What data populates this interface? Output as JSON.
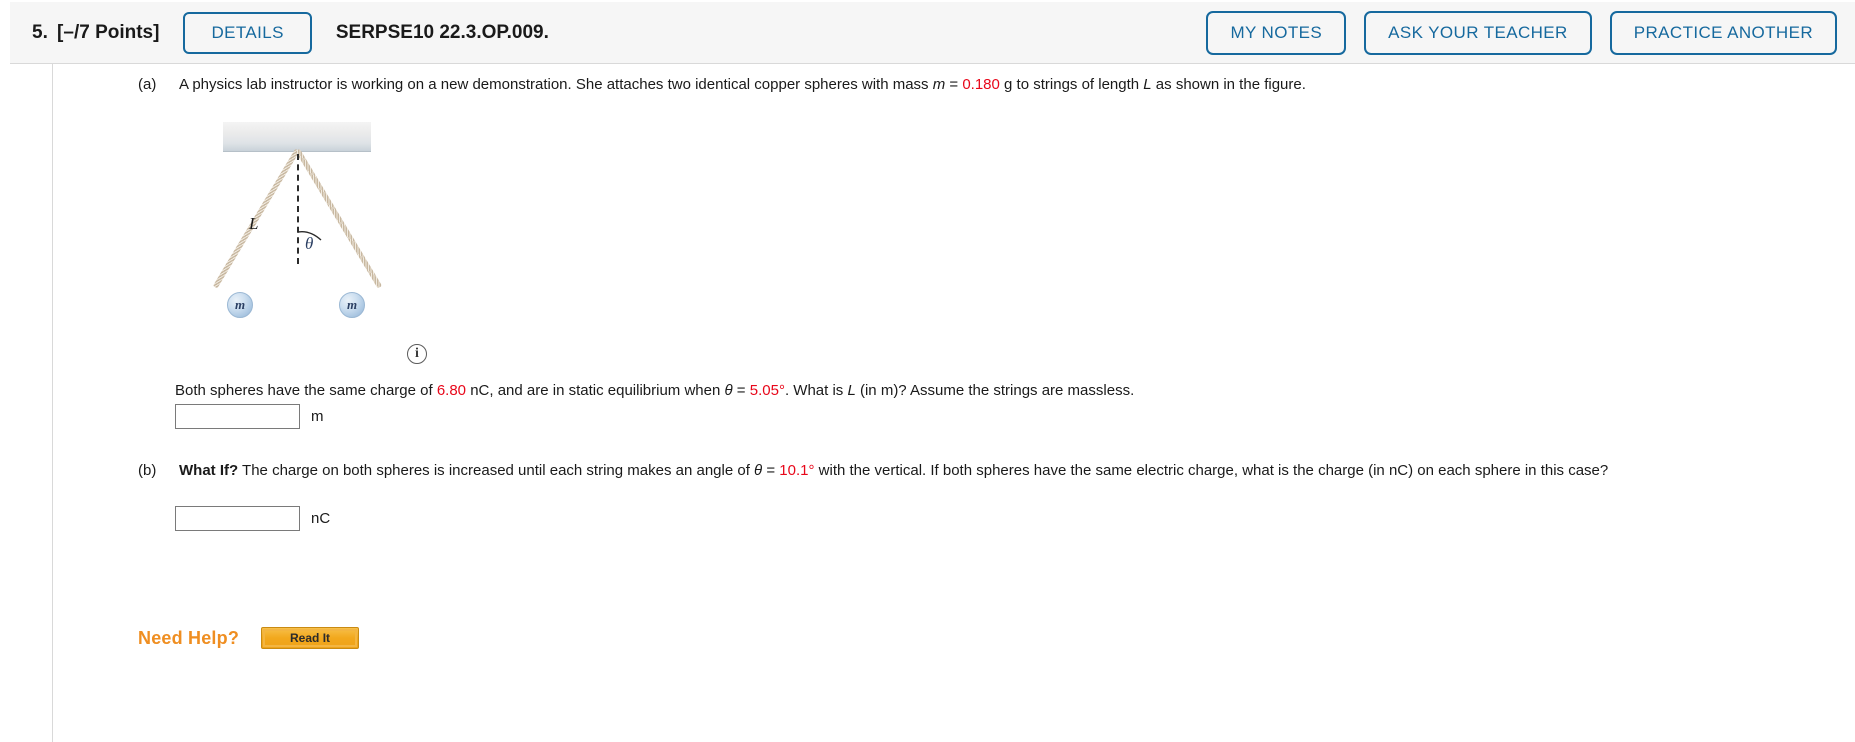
{
  "header": {
    "question_number": "5.",
    "points": "[–/7 Points]",
    "details_label": "DETAILS",
    "question_code": "SERPSE10 22.3.OP.009.",
    "buttons": [
      {
        "label": "MY NOTES"
      },
      {
        "label": "ASK YOUR TEACHER"
      },
      {
        "label": "PRACTICE ANOTHER"
      }
    ]
  },
  "parts": {
    "a": {
      "label": "(a)",
      "intro_1": "A physics lab instructor is working on a new demonstration. She attaches two identical copper spheres with mass ",
      "intro_m": "m",
      "intro_eq": " = ",
      "intro_mass_value": "0.180",
      "intro_2": " g to strings of length ",
      "intro_L": "L",
      "intro_3": " as shown in the figure.",
      "question_1": "Both spheres have the same charge of ",
      "charge_value": "6.80",
      "question_2": " nC, and are in static equilibrium when ",
      "theta_symbol": "θ",
      "question_eq": " = ",
      "theta_value": "5.05",
      "degree": "°",
      "question_3": ". What is ",
      "question_L": "L",
      "question_4": " (in m)? Assume the strings are massless.",
      "answer_value": "",
      "answer_unit": "m"
    },
    "b": {
      "label": "(b)",
      "whatif": "What If?",
      "text_1": " The charge on both spheres is increased until each string makes an angle of ",
      "theta_symbol": "θ",
      "text_eq": " = ",
      "theta_value": "10.1",
      "degree": "°",
      "text_2": " with the vertical. If both spheres have the same electric charge, what is the charge (in nC) on each sphere in this case?",
      "answer_value": "",
      "answer_unit": "nC"
    }
  },
  "figure": {
    "label_L": "L",
    "label_theta": "θ",
    "sphere_left_label": "m",
    "sphere_right_label": "m",
    "info_icon": "i"
  },
  "need_help": {
    "label": "Need Help?",
    "read_it_label": "Read It"
  },
  "colors": {
    "accent_blue": "#16699e",
    "value_red": "#e8071a",
    "help_orange": "#ef8e21",
    "button_orange": "#f2a81d"
  }
}
